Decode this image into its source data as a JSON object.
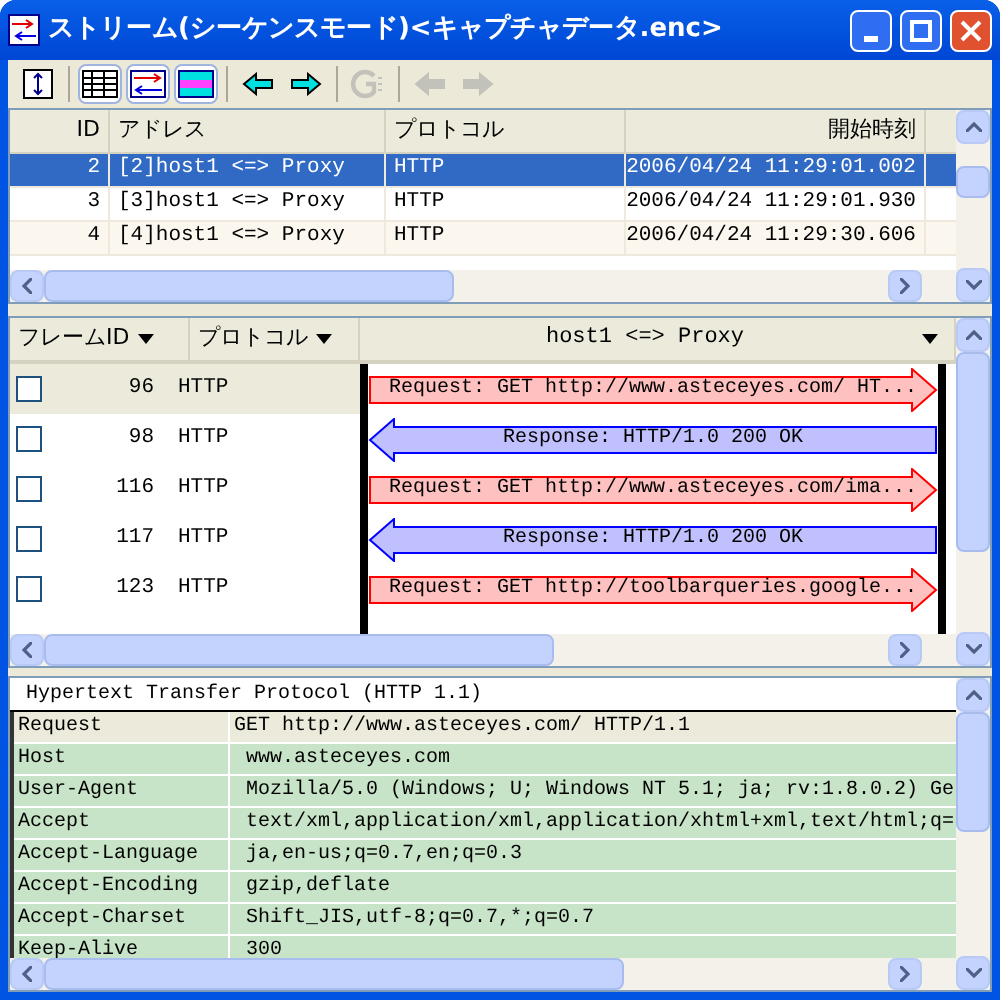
{
  "window": {
    "title": "ストリーム(シーケンスモード)<キャプチャデータ.enc>"
  },
  "toolbar": [
    {
      "kind": "expand",
      "disabled": false,
      "selected": false
    },
    {
      "kind": "grid",
      "disabled": false,
      "selected": true
    },
    {
      "kind": "sequence",
      "disabled": false,
      "selected": true
    },
    {
      "kind": "bands",
      "disabled": false,
      "selected": true
    },
    {
      "kind": "left",
      "disabled": false,
      "selected": false
    },
    {
      "kind": "right",
      "disabled": false,
      "selected": false
    },
    {
      "kind": "jump",
      "disabled": true,
      "selected": false
    },
    {
      "kind": "left",
      "disabled": true,
      "selected": false
    },
    {
      "kind": "right",
      "disabled": true,
      "selected": false
    }
  ],
  "streams": {
    "columns": [
      "ID",
      "アドレス",
      "プロトコル",
      "開始時刻"
    ],
    "rows": [
      {
        "id": "2",
        "address": "[2]host1 <=> Proxy",
        "protocol": "HTTP",
        "start": "2006/04/24 11:29:01.002",
        "selected": true
      },
      {
        "id": "3",
        "address": "[3]host1 <=> Proxy",
        "protocol": "HTTP",
        "start": "2006/04/24 11:29:01.930",
        "selected": false
      },
      {
        "id": "4",
        "address": "[4]host1 <=> Proxy",
        "protocol": "HTTP",
        "start": "2006/04/24 11:29:30.606",
        "selected": false
      }
    ]
  },
  "sequence": {
    "columns": [
      "フレームID",
      "プロトコル",
      "host1 <=> Proxy"
    ],
    "rows": [
      {
        "frame_id": "96",
        "protocol": "HTTP",
        "checked": false,
        "selected": true,
        "kind": "request",
        "message": "Request: GET http://www.asteceyes.com/ HT..."
      },
      {
        "frame_id": "98",
        "protocol": "HTTP",
        "checked": false,
        "selected": false,
        "kind": "response",
        "message": "Response: HTTP/1.0 200 OK"
      },
      {
        "frame_id": "116",
        "protocol": "HTTP",
        "checked": false,
        "selected": false,
        "kind": "request",
        "message": "Request: GET http://www.asteceyes.com/ima..."
      },
      {
        "frame_id": "117",
        "protocol": "HTTP",
        "checked": false,
        "selected": false,
        "kind": "response",
        "message": "Response: HTTP/1.0 200 OK"
      },
      {
        "frame_id": "123",
        "protocol": "HTTP",
        "checked": false,
        "selected": false,
        "kind": "request",
        "message": "Request: GET http://toolbarqueries.google..."
      }
    ]
  },
  "detail": {
    "title": "Hypertext Transfer Protocol (HTTP 1.1)",
    "rows": [
      {
        "name": "Request",
        "value": "GET http://www.asteceyes.com/ HTTP/1.1",
        "selected": true
      },
      {
        "name": "Host",
        "value": "www.asteceyes.com",
        "selected": false
      },
      {
        "name": "User-Agent",
        "value": "Mozilla/5.0 (Windows; U; Windows NT 5.1; ja; rv:1.8.0.2) Ge",
        "selected": false
      },
      {
        "name": "Accept",
        "value": "text/xml,application/xml,application/xhtml+xml,text/html;q=",
        "selected": false
      },
      {
        "name": "Accept-Language",
        "value": "ja,en-us;q=0.7,en;q=0.3",
        "selected": false
      },
      {
        "name": "Accept-Encoding",
        "value": "gzip,deflate",
        "selected": false
      },
      {
        "name": "Accept-Charset",
        "value": "Shift_JIS,utf-8;q=0.7,*;q=0.7",
        "selected": false
      },
      {
        "name": "Keep-Alive",
        "value": "300",
        "selected": false
      }
    ]
  }
}
